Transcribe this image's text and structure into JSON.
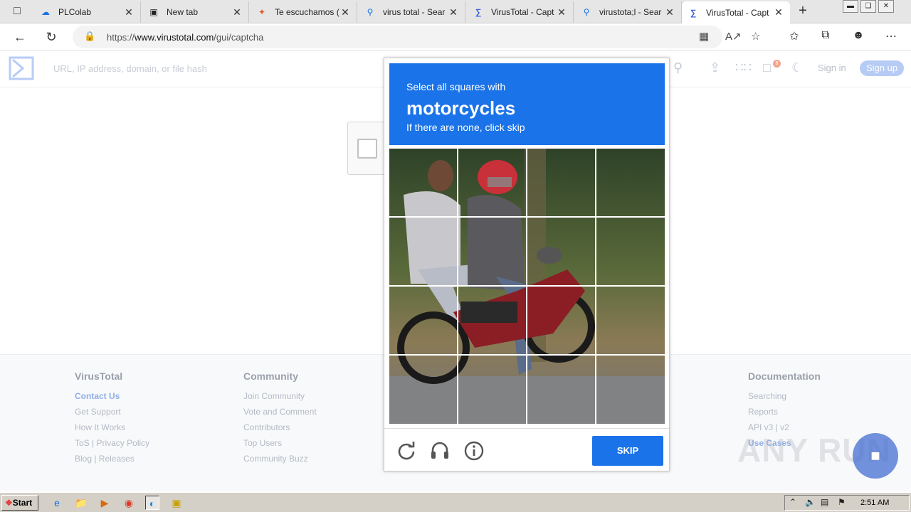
{
  "browser": {
    "tabs": [
      {
        "title": "PLColab",
        "icon": "cloud-icon",
        "color": "#1a73e8"
      },
      {
        "title": "New tab",
        "icon": "newtab-icon",
        "color": "#333333"
      },
      {
        "title": "Te escuchamos (",
        "icon": "feedback-icon",
        "color": "#e05a2a"
      },
      {
        "title": "virus total - Sear",
        "icon": "search-icon",
        "color": "#1a73e8"
      },
      {
        "title": "VirusTotal - Capt",
        "icon": "virustotal-icon",
        "color": "#3b61d5"
      },
      {
        "title": "virustota;l - Sear",
        "icon": "search-icon",
        "color": "#1a73e8"
      },
      {
        "title": "VirusTotal - Capt",
        "icon": "virustotal-icon",
        "color": "#3b61d5",
        "active": true
      }
    ],
    "url_prefix": "https://",
    "url_domain": "www.virustotal.com",
    "url_path": "/gui/captcha"
  },
  "vt": {
    "search_placeholder": "URL, IP address, domain, or file hash",
    "signin": "Sign in",
    "signup": "Sign up",
    "notification_count": "8"
  },
  "captcha": {
    "line1": "Select all squares with",
    "target": "motorcycles",
    "line3": "If there are none, click skip",
    "skip_label": "SKIP",
    "grid": "4x4"
  },
  "footer": {
    "virustotal": {
      "heading": "VirusTotal",
      "links": [
        "Contact Us",
        "Get Support",
        "How It Works",
        "ToS | Privacy Policy",
        "Blog | Releases"
      ]
    },
    "community": {
      "heading": "Community",
      "links": [
        "Join Community",
        "Vote and Comment",
        "Contributors",
        "Top Users",
        "Community Buzz"
      ]
    },
    "documentation": {
      "heading": "Documentation",
      "links": [
        "Searching",
        "Reports",
        "API v3 | v2",
        "Use Cases"
      ]
    }
  },
  "watermark": "ANY RUN",
  "taskbar": {
    "start_label": "Start",
    "clock": "2:51 AM"
  },
  "colors": {
    "captcha_blue": "#1a73e8",
    "vt_logo": "#3b61d5"
  }
}
